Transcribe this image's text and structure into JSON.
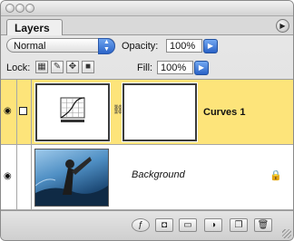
{
  "panel": {
    "tab_label": "Layers",
    "menu_icon": "panel-menu-arrow"
  },
  "controls": {
    "blend_mode": "Normal",
    "opacity_label": "Opacity:",
    "opacity_value": "100%",
    "lock_label": "Lock:",
    "fill_label": "Fill:",
    "fill_value": "100%"
  },
  "layers": [
    {
      "name": "Curves 1",
      "type": "adjustment-curves",
      "visible": true,
      "selected": true,
      "locked": false
    },
    {
      "name": "Background",
      "type": "image",
      "visible": true,
      "selected": false,
      "locked": true
    }
  ],
  "bottom_buttons": [
    "layer-style-icon",
    "add-mask-icon",
    "new-group-icon",
    "new-adjustment-layer-icon",
    "new-layer-icon",
    "delete-layer-icon"
  ],
  "colors": {
    "selected_row": "#fde47a",
    "accent_blue": "#2b64c8"
  }
}
